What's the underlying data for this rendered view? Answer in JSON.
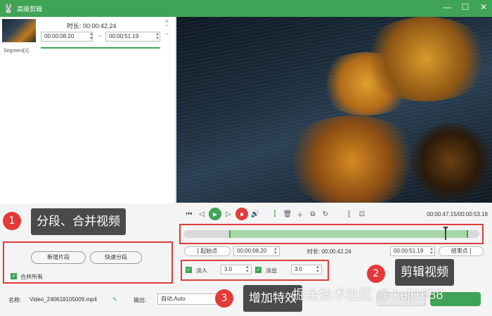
{
  "window": {
    "logo_glyph": "🐰",
    "title": "高级剪辑",
    "controls": {
      "minimize": "—",
      "maximize": "☐",
      "close": "✕"
    }
  },
  "segment": {
    "label": "Segment[1]",
    "duration_label": "时长: 00:00:42.24",
    "start_time": "00:00:08.20",
    "end_time": "00:00:51.19",
    "separator": "~"
  },
  "player": {
    "time_readout": "00:00:47.15/00:00:53.18"
  },
  "timeline": {
    "duration_total_s": 53.18,
    "selection_start_s": 8.2,
    "selection_end_s": 51.19,
    "playhead_s": 47.15
  },
  "range": {
    "start_btn": "起始点",
    "start_value": "00:00:08.20",
    "duration_label": "时长: 00:00:42.24",
    "end_value": "00:00:51.19",
    "end_btn": "结束点",
    "bracket_open": "[",
    "bracket_close": "]"
  },
  "left_controls": {
    "add_segment": "新增片段",
    "quick_split": "快速分段",
    "merge_all": "合并所有"
  },
  "fade": {
    "fade_in_label": "淡入",
    "fade_in_value": "3.0",
    "fade_out_label": "淡出",
    "fade_out_value": "3.0"
  },
  "bottom": {
    "name_label": "名称:",
    "filename": "Video_240618105009.mp4",
    "output_label": "输出:",
    "output_value": "自动,Auto"
  },
  "annotations": {
    "callout_1": "分段、合并视频",
    "callout_2": "剪辑视频",
    "callout_3": "增加特效",
    "badge_1": "1",
    "badge_2": "2",
    "badge_3": "3",
    "watermark": "掘金技术社区 @ keji1688"
  },
  "colors": {
    "accent": "#3fa455",
    "highlight_red": "#e03a3a",
    "callout_bg": "#4a4a4a"
  }
}
